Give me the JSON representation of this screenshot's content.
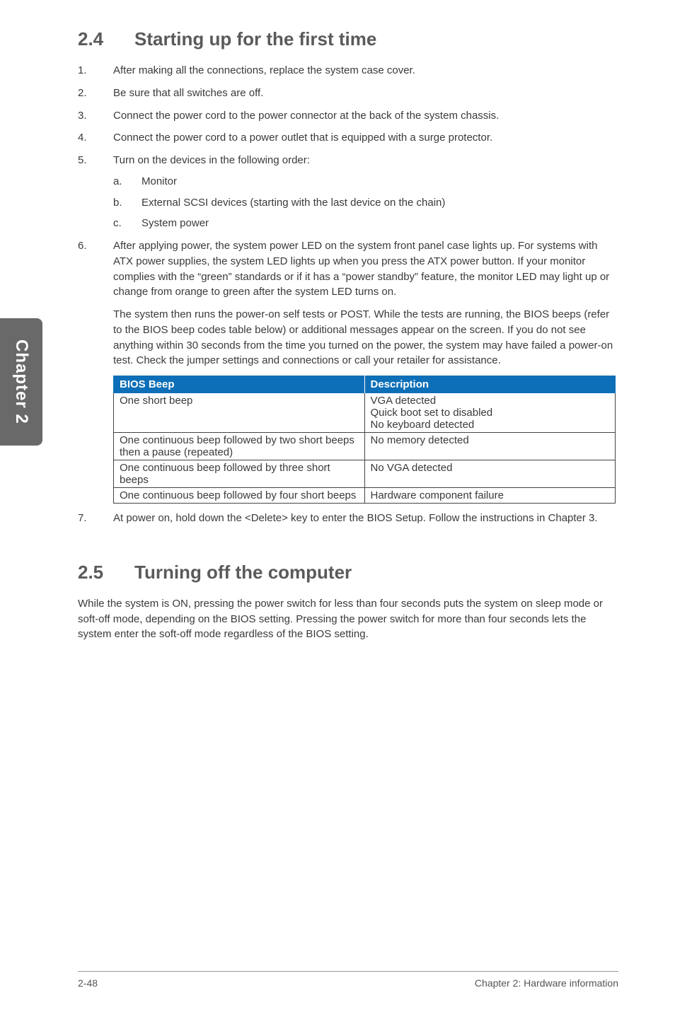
{
  "sideTab": "Chapter 2",
  "section1": {
    "num": "2.4",
    "title": "Starting up for the first time",
    "items": [
      "After making all the connections, replace the system case cover.",
      "Be sure that all switches are off.",
      "Connect the power cord to the power connector at the back of the system chassis.",
      "Connect the power cord to a power outlet that is equipped with a surge protector.",
      "Turn on the devices in the following order:"
    ],
    "subItems": [
      "Monitor",
      "External SCSI devices (starting with the last device on the chain)",
      "System power"
    ],
    "item6p1": "After applying power, the system power LED on the system front panel case lights up. For systems with ATX power supplies, the system LED lights up when you press the ATX power button. If your monitor complies with the “green” standards or if it has a “power standby” feature, the monitor LED may light up or change from orange to green after the system LED turns on.",
    "item6p2": "The system then runs the power-on self tests or POST. While the tests are running, the BIOS beeps (refer to the BIOS beep codes table below) or additional messages appear on the screen. If you do not see anything within 30 seconds from the time you turned on the power, the system may have failed a power-on test. Check the jumper settings and connections or call your retailer for assistance.",
    "table": {
      "headers": [
        "BIOS Beep",
        "Description"
      ],
      "rows": [
        {
          "beep": "One short beep",
          "desc": "VGA detected\nQuick boot set to disabled\nNo keyboard detected"
        },
        {
          "beep": "One continuous beep followed by two short beeps then a pause (repeated)",
          "desc": "No memory detected"
        },
        {
          "beep": "One continuous beep followed by three short beeps",
          "desc": "No VGA detected"
        },
        {
          "beep": "One continuous beep followed by four short beeps",
          "desc": "Hardware component failure"
        }
      ]
    },
    "item7": "At power on, hold down the <Delete> key to enter the BIOS Setup. Follow the instructions in Chapter 3."
  },
  "section2": {
    "num": "2.5",
    "title": "Turning off the computer",
    "para": "While the system is ON, pressing the power switch for less than four seconds puts the system on sleep mode or soft-off mode, depending on the BIOS setting. Pressing the power switch for more than four seconds lets the system enter the soft-off mode regardless of the BIOS setting."
  },
  "footer": {
    "left": "2-48",
    "right": "Chapter 2: Hardware information"
  }
}
